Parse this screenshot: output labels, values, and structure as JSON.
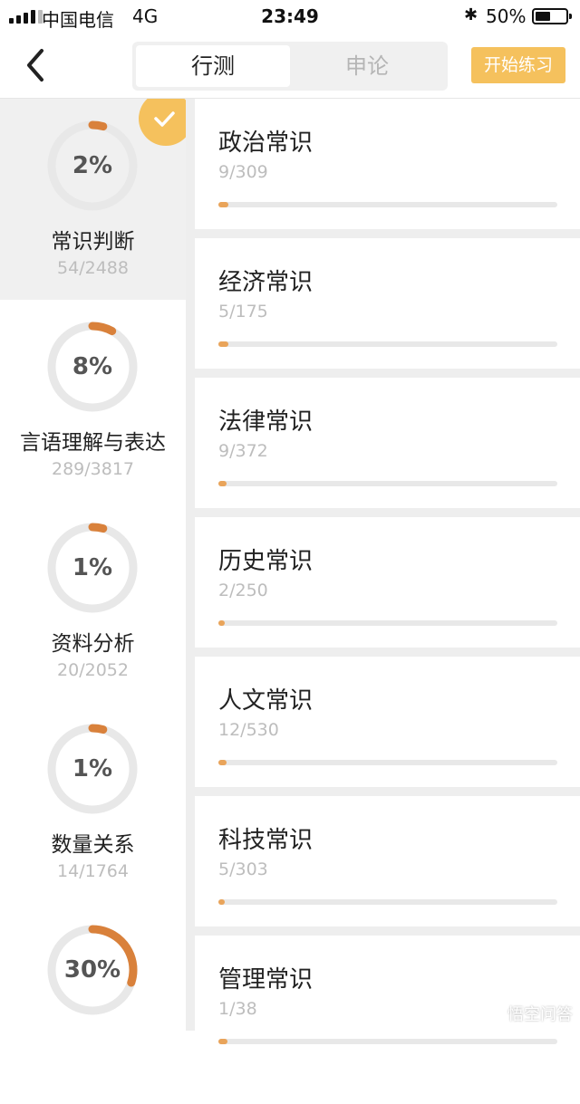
{
  "status_bar": {
    "carrier": "中国电信",
    "network": "4G",
    "time": "23:49",
    "battery": "50%",
    "battery_level": 0.5
  },
  "nav": {
    "back_icon": "chevron-left-icon",
    "tabs": [
      {
        "label": "行测",
        "active": true
      },
      {
        "label": "申论",
        "active": false
      }
    ],
    "start_button": "开始练习"
  },
  "colors": {
    "accent": "#f5c15d",
    "progress": "#e9a45a",
    "ring": "#d9813b",
    "ring_track": "#e8e8e8"
  },
  "categories": [
    {
      "percent": "2%",
      "name": "常识判断",
      "count": "54/2488",
      "progress": 0.02,
      "selected": true
    },
    {
      "percent": "8%",
      "name": "言语理解与表达",
      "count": "289/3817",
      "progress": 0.08,
      "selected": false
    },
    {
      "percent": "1%",
      "name": "资料分析",
      "count": "20/2052",
      "progress": 0.01,
      "selected": false
    },
    {
      "percent": "1%",
      "name": "数量关系",
      "count": "14/1764",
      "progress": 0.01,
      "selected": false
    },
    {
      "percent": "30%",
      "name": "",
      "count": "",
      "progress": 0.3,
      "selected": false
    }
  ],
  "subcategories": [
    {
      "title": "政治常识",
      "count": "9/309",
      "progress": 0.029
    },
    {
      "title": "经济常识",
      "count": "5/175",
      "progress": 0.029
    },
    {
      "title": "法律常识",
      "count": "9/372",
      "progress": 0.024
    },
    {
      "title": "历史常识",
      "count": "2/250",
      "progress": 0.008
    },
    {
      "title": "人文常识",
      "count": "12/530",
      "progress": 0.023
    },
    {
      "title": "科技常识",
      "count": "5/303",
      "progress": 0.017
    },
    {
      "title": "管理常识",
      "count": "1/38",
      "progress": 0.026
    }
  ],
  "watermark": "悟空问答"
}
